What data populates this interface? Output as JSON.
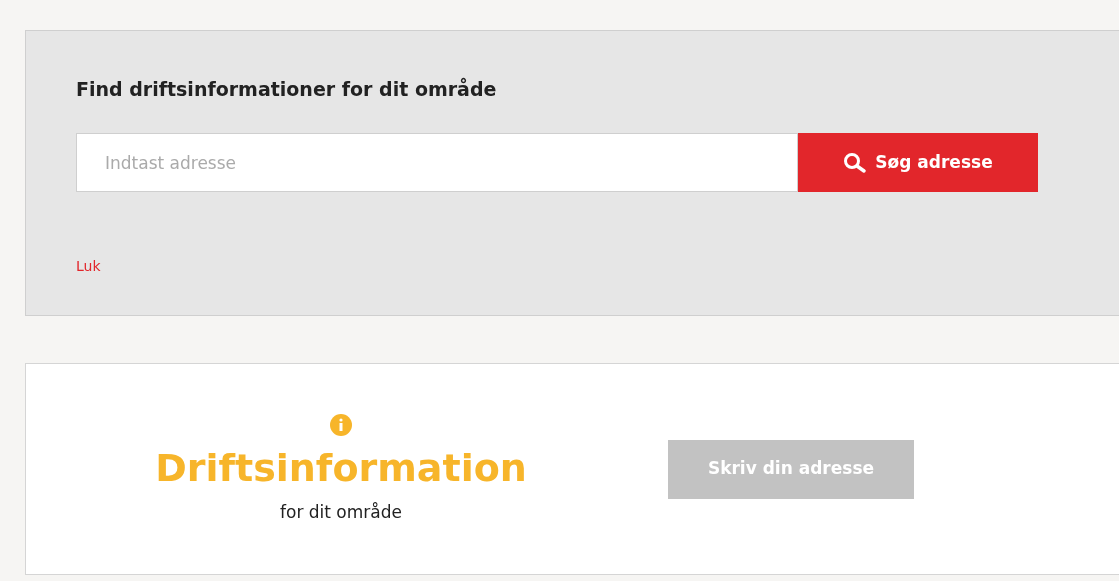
{
  "search_panel": {
    "title": "Find driftsinformationer for dit område",
    "field": {
      "placeholder": "Indtast adresse"
    },
    "button": "Søg adresse",
    "close_link": "Luk"
  },
  "info_card": {
    "heading": "Driftsinformation",
    "subheading": "for dit område",
    "button": {
      "label": "Skriv din adresse",
      "disabled": true
    }
  }
}
